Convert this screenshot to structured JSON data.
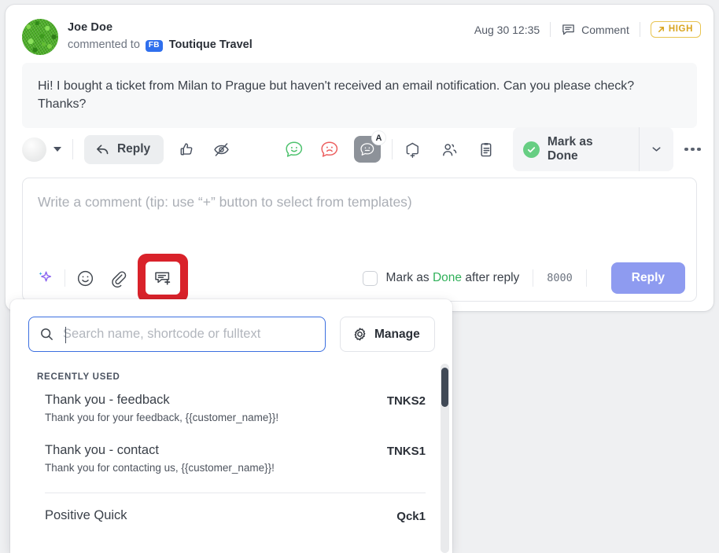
{
  "header": {
    "user_name": "Joe Doe",
    "action_prefix": "commented to",
    "channel_badge": "FB",
    "page_name": "Toutique Travel",
    "timestamp": "Aug 30 12:35",
    "type_label": "Comment",
    "priority_label": "HIGH",
    "priority_color": "#d9a520"
  },
  "message": {
    "text": "Hi! I bought a ticket from Milan to Prague but haven't received an email notification. Can you please check? Thanks?"
  },
  "toolbar": {
    "reply_label": "Reply",
    "mark_done_label": "Mark as Done",
    "icons": [
      "avatar-selector-icon",
      "reply-arrow-icon",
      "thumbs-up-icon",
      "hide-eye-icon",
      "sentiment-positive-icon",
      "sentiment-negative-icon",
      "sentiment-auto-icon",
      "tag-add-icon",
      "assign-user-icon",
      "clipboard-icon",
      "more-options-icon"
    ],
    "sentiment_auto_badge": "A"
  },
  "composer": {
    "placeholder": "Write a comment (tip: use “+” button to select from templates)",
    "value": "",
    "ai_icon": "sparkle-icon",
    "emoji_icon": "emoji-smiley-icon",
    "attach_icon": "paperclip-icon",
    "template_icon": "template-add-icon",
    "checkbox_checked": false,
    "checkbox_prefix": "Mark as",
    "checkbox_highlight": "Done",
    "checkbox_suffix": "after reply",
    "char_counter": "8000",
    "reply_button": "Reply",
    "reply_button_color": "#8e9bf0"
  },
  "template_panel": {
    "search_placeholder": "Search name, shortcode or fulltext",
    "search_value": "",
    "search_icon": "search-icon",
    "manage_label": "Manage",
    "manage_icon": "gear-icon",
    "section_title": "RECENTLY USED",
    "templates": [
      {
        "name": "Thank you - feedback",
        "description": "Thank you for your feedback, {{customer_name}}!",
        "code": "TNKS2"
      },
      {
        "name": "Thank you - contact",
        "description": "Thank you for contacting us, {{customer_name}}!",
        "code": "TNKS1"
      },
      {
        "name": "Positive Quick",
        "description": "",
        "code": "Qck1"
      }
    ]
  }
}
